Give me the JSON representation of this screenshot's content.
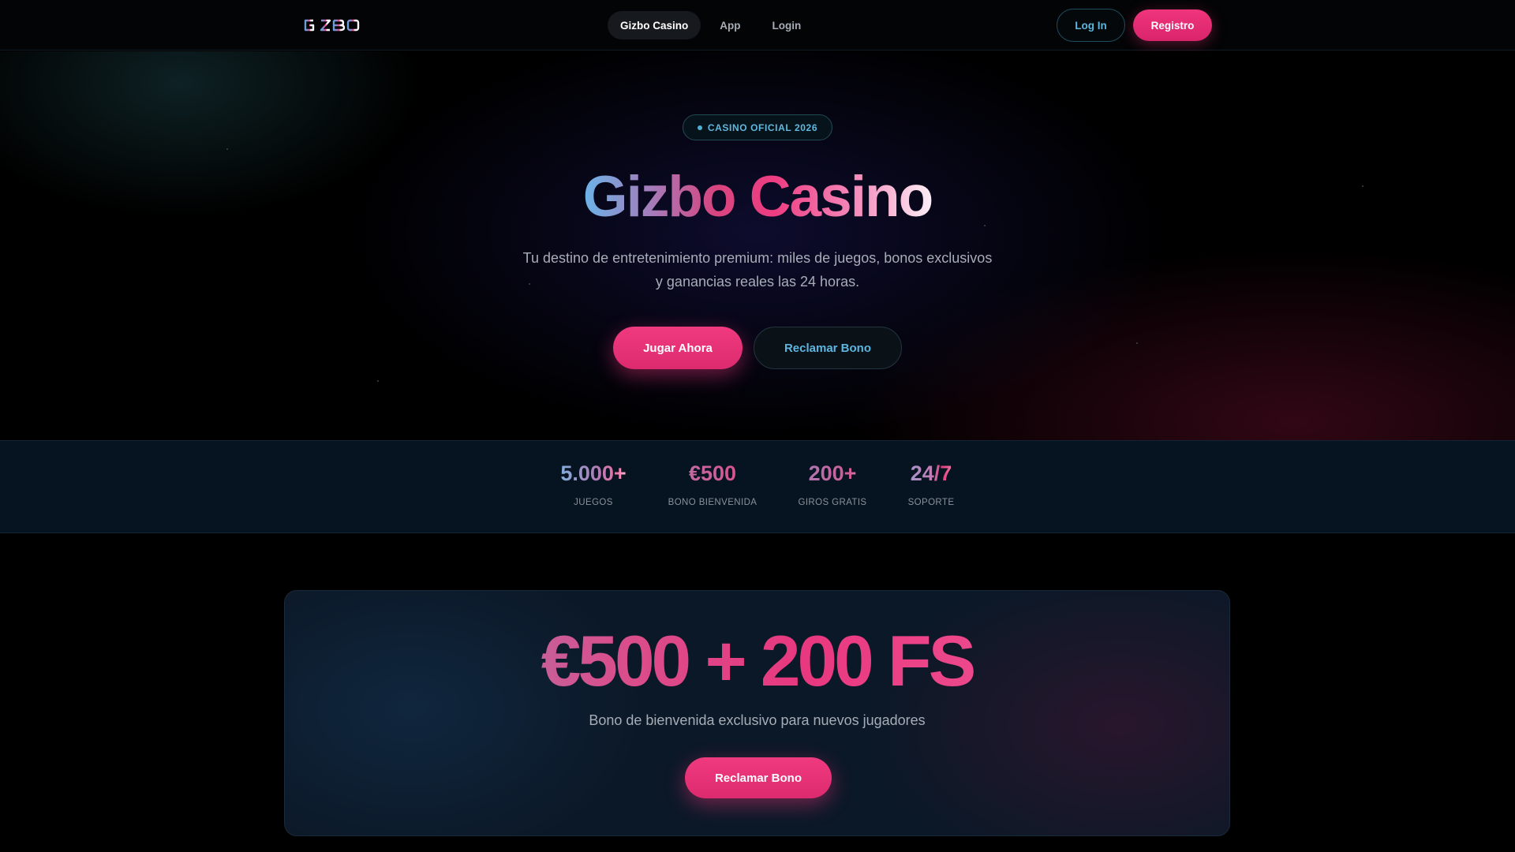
{
  "nav": {
    "logo": "GIZBO",
    "links": [
      {
        "label": "Gizbo Casino",
        "active": true
      },
      {
        "label": "App",
        "active": false
      },
      {
        "label": "Login",
        "active": false
      }
    ],
    "login_button": "Log In",
    "register_button": "Registro"
  },
  "hero": {
    "badge": "CASINO OFICIAL 2026",
    "title": "Gizbo Casino",
    "subtitle": "Tu destino de entretenimiento premium: miles de juegos, bonos exclusivos y ganancias reales las 24 horas.",
    "primary_button": "Jugar Ahora",
    "secondary_button": "Reclamar Bono"
  },
  "stats": [
    {
      "value": "5.000+",
      "label": "JUEGOS"
    },
    {
      "value": "€500",
      "label": "BONO BIENVENIDA"
    },
    {
      "value": "200+",
      "label": "GIROS GRATIS"
    },
    {
      "value": "24/7",
      "label": "SOPORTE"
    }
  ],
  "promo": {
    "title": "€500 + 200 FS",
    "subtitle": "Bono de bienvenida exclusivo para nuevos jugadores",
    "button": "Reclamar Bono"
  },
  "colors": {
    "accent_pink": "#ec347c",
    "accent_blue": "#5db6e0",
    "background": "#000000",
    "panel": "#0b1827"
  }
}
